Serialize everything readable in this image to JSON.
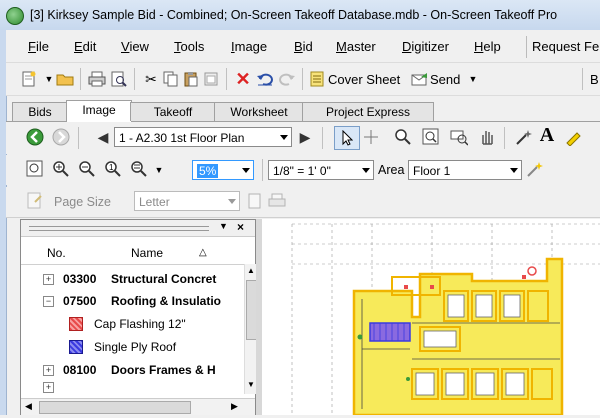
{
  "window": {
    "title": "[3] Kirksey Sample Bid - Combined; On-Screen Takeoff Database.mdb - On-Screen Takeoff Pro"
  },
  "menu": [
    {
      "label": "File",
      "u": "F",
      "rest": "ile"
    },
    {
      "label": "Edit",
      "u": "E",
      "rest": "dit"
    },
    {
      "label": "View",
      "u": "V",
      "rest": "iew"
    },
    {
      "label": "Tools",
      "u": "T",
      "rest": "ools"
    },
    {
      "label": "Image",
      "u": "I",
      "rest": "mage"
    },
    {
      "label": "Bid",
      "u": "B",
      "rest": "id"
    },
    {
      "label": "Master",
      "u": "M",
      "rest": "aster"
    },
    {
      "label": "Digitizer",
      "u": "D",
      "rest": "igitizer"
    },
    {
      "label": "Help",
      "u": "H",
      "rest": "elp"
    },
    {
      "label": "Request Fe",
      "u": "",
      "rest": "Request Fe"
    }
  ],
  "toolbar1": {
    "cover_sheet": "Cover Sheet",
    "send": "Send",
    "more": "B"
  },
  "tabs": [
    "Bids",
    "Image",
    "Takeoff",
    "Worksheet",
    "Project Express"
  ],
  "active_tab": "Image",
  "page_select": "1 - A2.30 1st Floor Plan",
  "zoom": "5%",
  "scale": "1/8\" = 1' 0\"",
  "area_label": "Area",
  "area_value": "Floor 1",
  "page_size_label": "Page Size",
  "page_size_value": "Letter",
  "list": {
    "col_no": "No.",
    "col_name": "Name",
    "rows": [
      {
        "code": "03300",
        "name": "Structural Concret",
        "type": "group"
      },
      {
        "code": "07500",
        "name": "Roofing & Insulatio",
        "type": "group"
      },
      {
        "name": "Cap Flashing 12\"",
        "color": "#e84a4a",
        "type": "item"
      },
      {
        "name": "Single Ply Roof",
        "color": "#3a3ae0",
        "type": "item"
      },
      {
        "code": "08100",
        "name": "Doors Frames & H",
        "type": "group"
      }
    ]
  },
  "colors": {
    "accent": "#3399ff",
    "highlight": "#f7ea5a",
    "outline": "#f0b400"
  }
}
